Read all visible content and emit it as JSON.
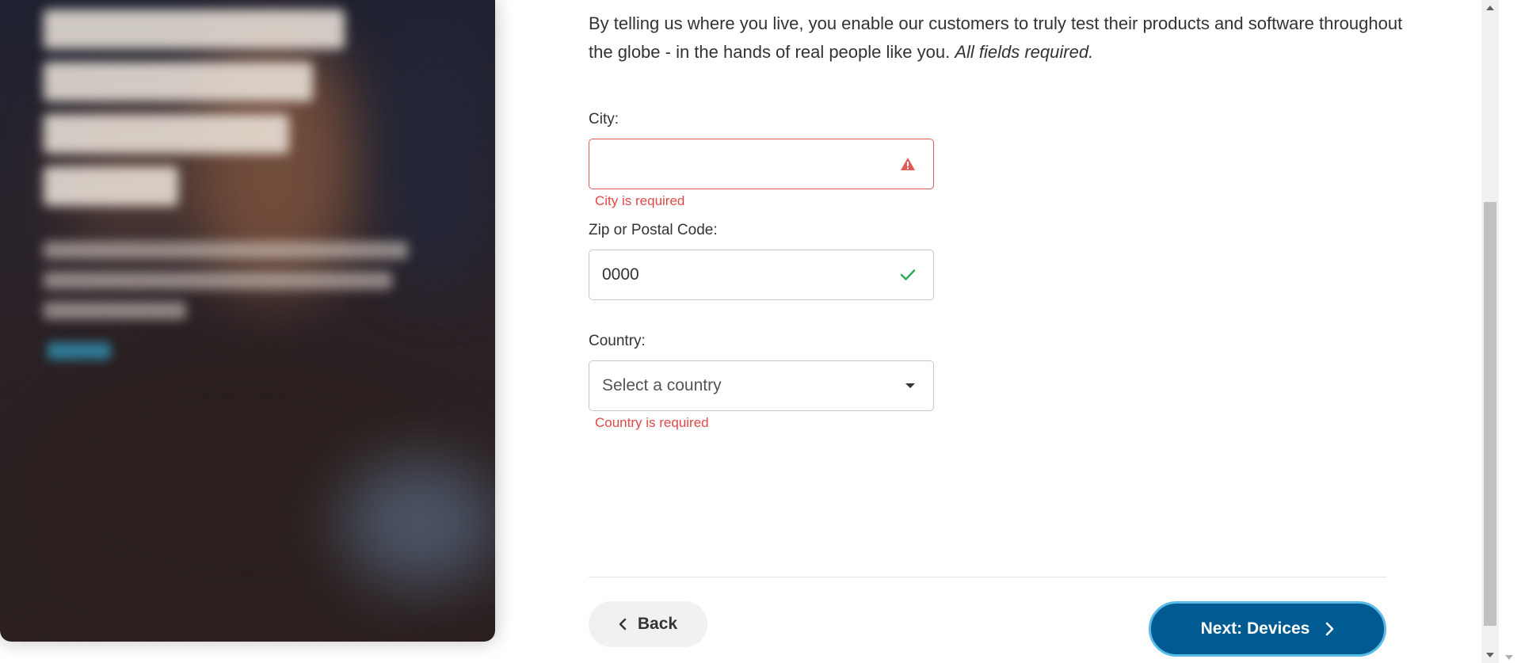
{
  "intro": {
    "text": "By telling us where you live, you enable our customers to truly test their products and software throughout the globe - in the hands of real people like you.",
    "required_note": "All fields required."
  },
  "city": {
    "label": "City:",
    "value": "",
    "error": "City is required",
    "status_icon": "warning-icon"
  },
  "zip": {
    "label": "Zip or Postal Code:",
    "value": "0000",
    "status_icon": "check-icon"
  },
  "country": {
    "label": "Country:",
    "selected": "Select a country",
    "error": "Country is required",
    "caret_icon": "caret-down-icon"
  },
  "nav": {
    "back_label": "Back",
    "next_label": "Next: Devices"
  },
  "colors": {
    "error": "#e15a5a",
    "success": "#2eaa55",
    "primary": "#005b92",
    "focus_ring": "#5bbbe8"
  }
}
